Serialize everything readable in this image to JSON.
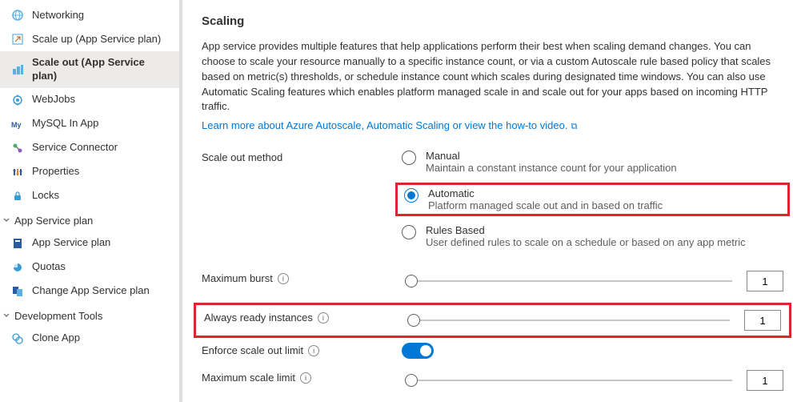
{
  "sidebar": {
    "items": [
      {
        "label": "Networking"
      },
      {
        "label": "Scale up (App Service plan)"
      },
      {
        "label": "Scale out (App Service plan)"
      },
      {
        "label": "WebJobs"
      },
      {
        "label": "MySQL In App"
      },
      {
        "label": "Service Connector"
      },
      {
        "label": "Properties"
      },
      {
        "label": "Locks"
      }
    ],
    "group1": "App Service plan",
    "group1_items": [
      {
        "label": "App Service plan"
      },
      {
        "label": "Quotas"
      },
      {
        "label": "Change App Service plan"
      }
    ],
    "group2": "Development Tools",
    "group2_items": [
      {
        "label": "Clone App"
      }
    ]
  },
  "main": {
    "title": "Scaling",
    "description": "App service provides multiple features that help applications perform their best when scaling demand changes. You can choose to scale your resource manually to a specific instance count, or via a custom Autoscale rule based policy that scales based on metric(s) thresholds, or schedule instance count which scales during designated time windows. You can also use Automatic Scaling features which enables platform managed scale in and scale out for your apps based on incoming HTTP traffic.",
    "learn_more": "Learn more about Azure Autoscale, Automatic Scaling or view the how-to video.",
    "method_label": "Scale out method",
    "radios": {
      "manual": {
        "title": "Manual",
        "desc": "Maintain a constant instance count for your application"
      },
      "automatic": {
        "title": "Automatic",
        "desc": "Platform managed scale out and in based on traffic"
      },
      "rules": {
        "title": "Rules Based",
        "desc": "User defined rules to scale on a schedule or based on any app metric"
      }
    },
    "rows": {
      "max_burst": {
        "label": "Maximum burst",
        "value": "1"
      },
      "always_ready": {
        "label": "Always ready instances",
        "value": "1"
      },
      "enforce": {
        "label": "Enforce scale out limit"
      },
      "max_scale": {
        "label": "Maximum scale limit",
        "value": "1"
      }
    }
  }
}
